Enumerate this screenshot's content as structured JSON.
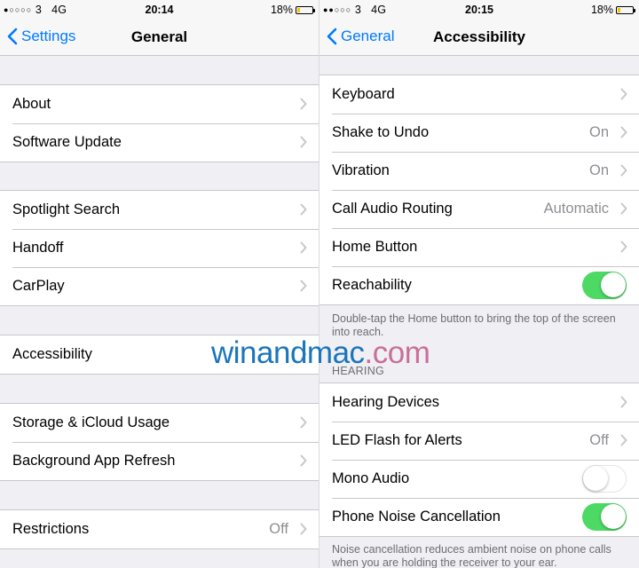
{
  "left": {
    "status": {
      "carrier": "3",
      "network": "4G",
      "time": "20:14",
      "battery": "18%",
      "battery_level": 0.18
    },
    "nav": {
      "back": "Settings",
      "title": "General"
    },
    "groups": [
      [
        {
          "label": "About"
        },
        {
          "label": "Software Update"
        }
      ],
      [
        {
          "label": "Spotlight Search"
        },
        {
          "label": "Handoff"
        },
        {
          "label": "CarPlay"
        }
      ],
      [
        {
          "label": "Accessibility"
        }
      ],
      [
        {
          "label": "Storage & iCloud Usage"
        },
        {
          "label": "Background App Refresh"
        }
      ],
      [
        {
          "label": "Restrictions",
          "value": "Off"
        }
      ]
    ]
  },
  "right": {
    "status": {
      "carrier": "3",
      "network": "4G",
      "time": "20:15",
      "battery": "18%",
      "battery_level": 0.18
    },
    "nav": {
      "back": "General",
      "title": "Accessibility"
    },
    "group1": [
      {
        "label": "Keyboard"
      },
      {
        "label": "Shake to Undo",
        "value": "On"
      },
      {
        "label": "Vibration",
        "value": "On"
      },
      {
        "label": "Call Audio Routing",
        "value": "Automatic"
      },
      {
        "label": "Home Button"
      },
      {
        "label": "Reachability",
        "toggle": true
      }
    ],
    "reachability_footer": "Double-tap the Home button to bring the top of the screen into reach.",
    "hearing_header": "HEARING",
    "group2": [
      {
        "label": "Hearing Devices"
      },
      {
        "label": "LED Flash for Alerts",
        "value": "Off"
      },
      {
        "label": "Mono Audio",
        "toggle": false
      },
      {
        "label": "Phone Noise Cancellation",
        "toggle": true
      }
    ],
    "noise_footer": "Noise cancellation reduces ambient noise on phone calls when you are holding the receiver to your ear."
  },
  "watermark": {
    "part1": "winandmac",
    "part2": ".com",
    "color1": "#1b75bb",
    "color2": "#c8709a"
  },
  "colors": {
    "accent": "#007aff",
    "toggle_on": "#4cd964",
    "battery": "#f5c300"
  },
  "icons": {
    "back": "chevron-left-icon",
    "disclosure": "chevron-right-icon",
    "signal": "signal-dots-icon",
    "battery": "battery-icon"
  }
}
